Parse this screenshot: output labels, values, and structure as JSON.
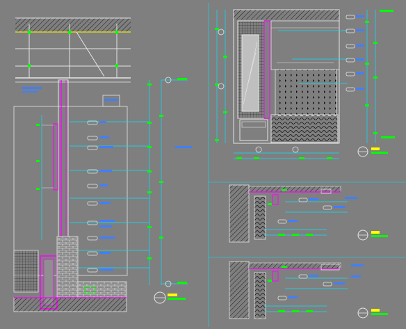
{
  "drawing": {
    "background": "#7f7f7f",
    "colors": {
      "frame": "#e6e6e6",
      "panel": "#ff00ff",
      "dimension": "#00e5ff",
      "annotation": "#00ff00",
      "tag": "#3f7fff",
      "highlight": "#ffff00",
      "hatch": "#1a1a1a",
      "white": "#ffffff"
    },
    "sheets": [
      {
        "id": "section-left",
        "type": "wall-section"
      },
      {
        "id": "elevation-top-right",
        "type": "interior-elevation"
      },
      {
        "id": "detail-mid-right",
        "type": "node-detail"
      },
      {
        "id": "detail-bottom-right",
        "type": "node-detail"
      }
    ],
    "icons": [
      "section-marker-icon",
      "title-symbol-icon",
      "grid-bubble-icon"
    ]
  }
}
